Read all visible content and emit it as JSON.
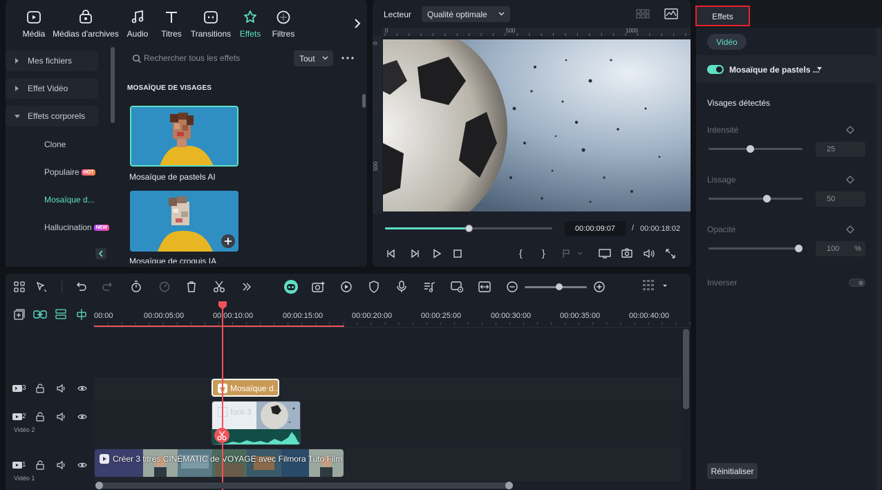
{
  "media_tabs": [
    {
      "label": "Média",
      "icon": "media-icon"
    },
    {
      "label": "Médias d'archives",
      "icon": "stock-icon"
    },
    {
      "label": "Audio",
      "icon": "audio-icon"
    },
    {
      "label": "Titres",
      "icon": "titles-icon"
    },
    {
      "label": "Transitions",
      "icon": "transitions-icon"
    },
    {
      "label": "Effets",
      "icon": "effects-icon",
      "active": true
    },
    {
      "label": "Filtres",
      "icon": "filters-icon"
    }
  ],
  "sidebar": {
    "items": [
      {
        "label": "Mes fichiers"
      },
      {
        "label": "Effet Vidéo"
      },
      {
        "label": "Effets corporels"
      }
    ],
    "subitems": [
      {
        "label": "Clone",
        "badge": ""
      },
      {
        "label": "Populaire",
        "badge": "HOT"
      },
      {
        "label": "Mosaïque d...",
        "badge": "",
        "active": true
      },
      {
        "label": "Hallucination",
        "badge": "NEW"
      }
    ]
  },
  "effects_browser": {
    "search_placeholder": "Rechercher tous les effets",
    "filter": "Tout",
    "section_title": "MOSAÏQUE DE VISAGES",
    "items": [
      {
        "label": "Mosaïque de pastels AI"
      },
      {
        "label": "Mosaïque de croquis IA"
      }
    ]
  },
  "player": {
    "label": "Lecteur",
    "quality": "Qualité optimale",
    "ruler_top": [
      "0",
      "500",
      "1000"
    ],
    "ruler_left": [
      "0",
      "500"
    ],
    "current_time": "00:00:09:07",
    "separator": "/",
    "total_time": "00:00:18:02",
    "progress": 0.5,
    "brackets": [
      "{",
      "}"
    ]
  },
  "timeline": {
    "ruler": [
      "00:00",
      "00:00:05:00",
      "00:00:10:00",
      "00:00:15:00",
      "00:00:20:00",
      "00:00:25:00",
      "00:00:30:00",
      "00:00:35:00",
      "00:00:40:00"
    ],
    "tracks": [
      {
        "num": "3",
        "label": ""
      },
      {
        "num": "2",
        "label": "Vidéo 2"
      },
      {
        "num": "1",
        "label": "Vidéo 1"
      }
    ],
    "clips": {
      "effect": "Mosaïque d...",
      "video2": "foot-3",
      "video1": "Créer 3 titres CINÉMATIC de VOYAGE avec Filmora  Tuto Film..."
    },
    "zoom": 0.55
  },
  "properties": {
    "tab": "Effets",
    "subtab": "Vidéo",
    "effect_name": "Mosaïque de pastels ...",
    "section": "Visages détectés",
    "params": [
      {
        "label": "Intensité",
        "value": "25",
        "unit": "",
        "level": 0.25
      },
      {
        "label": "Lissage",
        "value": "50",
        "unit": "",
        "level": 0.5
      },
      {
        "label": "Opacité",
        "value": "100",
        "unit": "%",
        "level": 1.0
      }
    ],
    "invert_label": "Inverser",
    "reset_label": "Réinitialiser"
  },
  "colors": {
    "accent": "#5fe0c4",
    "playhead": "#f0525a",
    "highlight": "#e8202a"
  }
}
